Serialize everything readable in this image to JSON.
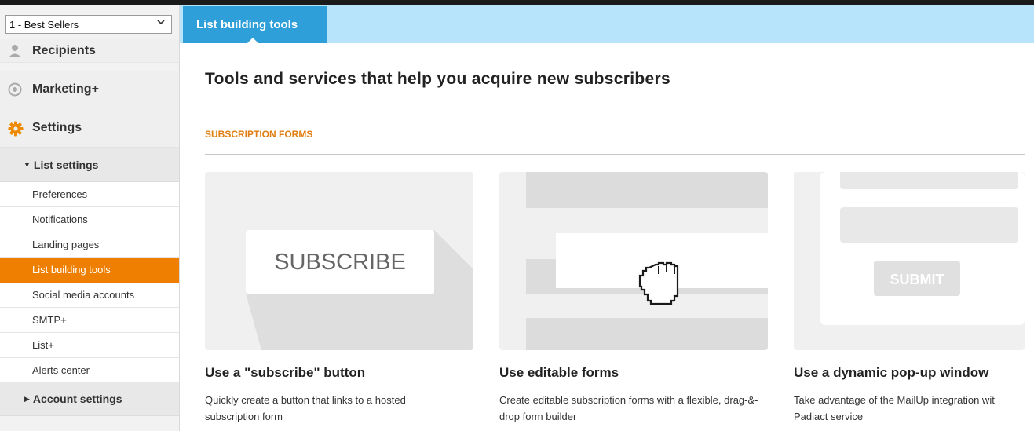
{
  "sidebar": {
    "list_selector": {
      "value": "1 - Best Sellers"
    },
    "main_items": [
      {
        "label": "Recipients",
        "icon": "person-icon"
      },
      {
        "label": "Marketing+",
        "icon": "target-icon"
      },
      {
        "label": "Settings",
        "icon": "gear-icon"
      }
    ],
    "list_settings": {
      "label": "List settings",
      "items": [
        {
          "label": "Preferences"
        },
        {
          "label": "Notifications"
        },
        {
          "label": "Landing pages"
        },
        {
          "label": "List building tools"
        },
        {
          "label": "Social media accounts"
        },
        {
          "label": "SMTP+"
        },
        {
          "label": "List+"
        },
        {
          "label": "Alerts center"
        }
      ],
      "active_item": "List building tools"
    },
    "account_settings": {
      "label": "Account settings"
    }
  },
  "tabbar": {
    "active_tab": "List building tools"
  },
  "main": {
    "title": "Tools and services that help you acquire new subscribers",
    "section_label": "SUBSCRIPTION FORMS",
    "cards": [
      {
        "title": "Use a \"subscribe\" button",
        "description": "Quickly create a button that links to a hosted subscription form",
        "image_text": "SUBSCRIBE"
      },
      {
        "title": "Use editable forms",
        "description": "Create editable subscription forms with a flexible, drag-&-drop form builder",
        "image_icon": "hand-cursor-icon"
      },
      {
        "title": "Use a dynamic pop-up window",
        "description": "Take advantage of the MailUp integration wit Padiact service",
        "image_text": "SUBMIT"
      }
    ]
  },
  "colors": {
    "accent_orange": "#ee7f00",
    "tab_blue": "#2e9fd9",
    "tabbar_light_blue": "#b8e4fb",
    "section_orange": "#e07e12"
  }
}
